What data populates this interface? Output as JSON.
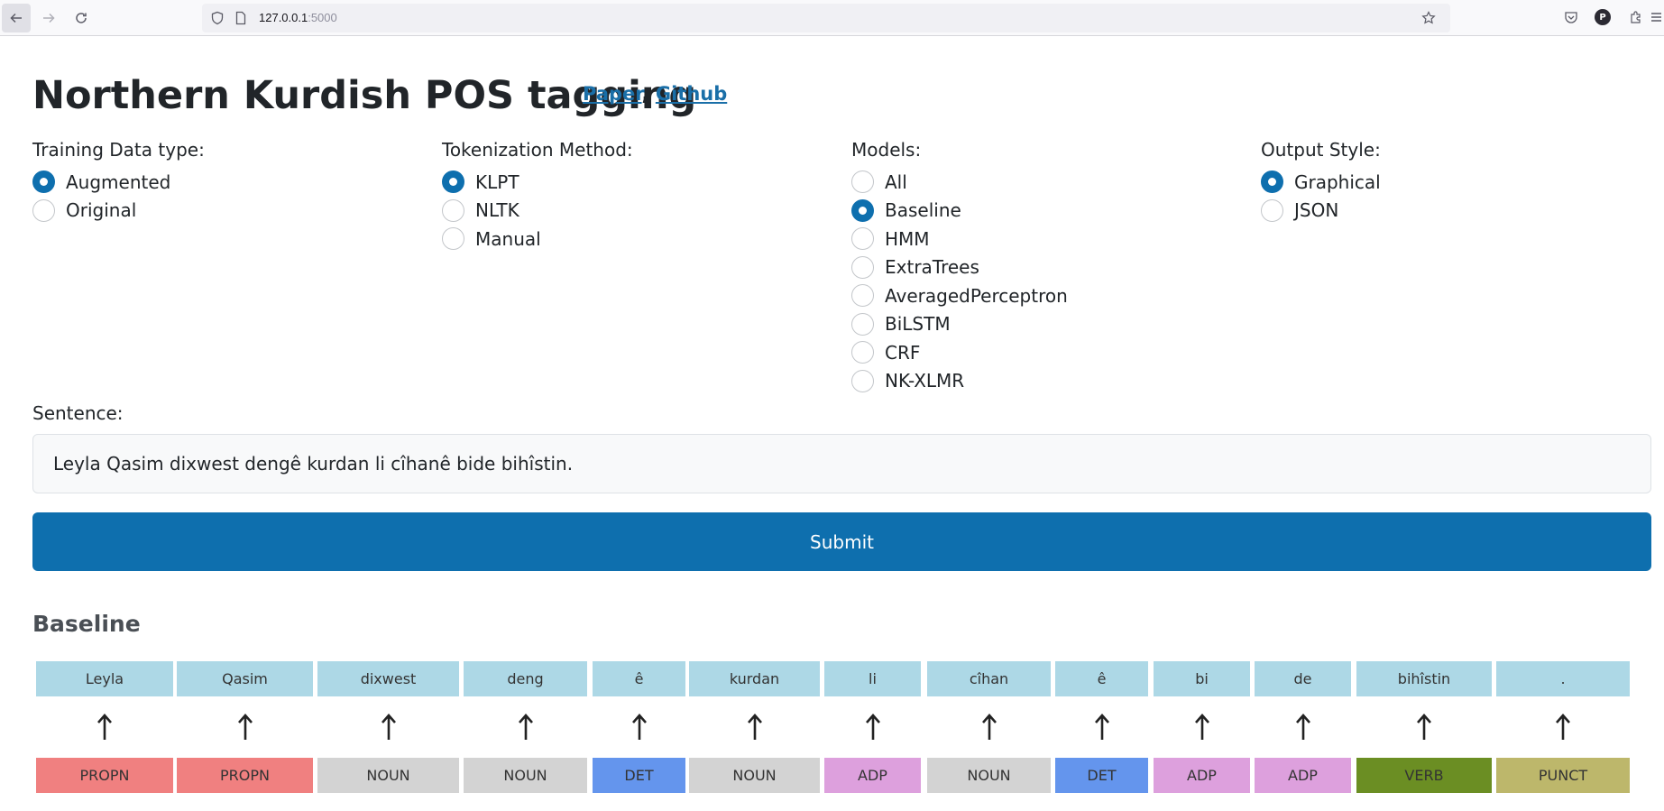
{
  "browser": {
    "url_host": "127.0.0.1",
    "url_port": ":5000"
  },
  "header": {
    "title": "Northern Kurdish POS tagging",
    "link_paper": "Paper",
    "separator": ",",
    "link_github": "Github"
  },
  "options": {
    "training": {
      "label": "Training Data type:",
      "items": [
        "Augmented",
        "Original"
      ],
      "selected": "Augmented"
    },
    "tokenization": {
      "label": "Tokenization Method:",
      "items": [
        "KLPT",
        "NLTK",
        "Manual"
      ],
      "selected": "KLPT"
    },
    "models": {
      "label": "Models:",
      "items": [
        "All",
        "Baseline",
        "HMM",
        "ExtraTrees",
        "AveragedPerceptron",
        "BiLSTM",
        "CRF",
        "NK-XLMR"
      ],
      "selected": "Baseline"
    },
    "output": {
      "label": "Output Style:",
      "items": [
        "Graphical",
        "JSON"
      ],
      "selected": "Graphical"
    }
  },
  "form": {
    "sentence_label": "Sentence:",
    "sentence_value": "Leyla Qasim dixwest dengê kurdan li cîhanê bide bihîstin.",
    "submit_label": "Submit"
  },
  "result": {
    "title": "Baseline",
    "tokens": [
      {
        "token": "Leyla",
        "tag": "PROPN",
        "color": "#f08080"
      },
      {
        "token": "Qasim",
        "tag": "PROPN",
        "color": "#f08080"
      },
      {
        "token": "dixwest",
        "tag": "NOUN",
        "color": "#d3d3d3"
      },
      {
        "token": "deng",
        "tag": "NOUN",
        "color": "#d3d3d3"
      },
      {
        "token": "ê",
        "tag": "DET",
        "color": "#6495ed"
      },
      {
        "token": "kurdan",
        "tag": "NOUN",
        "color": "#d3d3d3"
      },
      {
        "token": "li",
        "tag": "ADP",
        "color": "#dda0dd"
      },
      {
        "token": "cîhan",
        "tag": "NOUN",
        "color": "#d3d3d3"
      },
      {
        "token": "ê",
        "tag": "DET",
        "color": "#6495ed"
      },
      {
        "token": "bi",
        "tag": "ADP",
        "color": "#dda0dd"
      },
      {
        "token": "de",
        "tag": "ADP",
        "color": "#dda0dd"
      },
      {
        "token": "bihîstin",
        "tag": "VERB",
        "color": "#6b8e23"
      },
      {
        "token": ".",
        "tag": "PUNCT",
        "color": "#bdb76b"
      }
    ]
  }
}
